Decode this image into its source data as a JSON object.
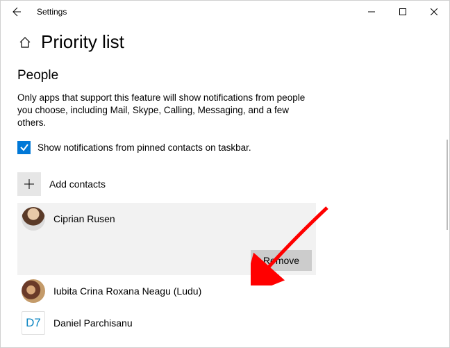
{
  "titlebar": {
    "title": "Settings"
  },
  "header": {
    "title": "Priority list"
  },
  "section": {
    "heading": "People",
    "description": "Only apps that support this feature will show notifications from people you choose, including Mail, Skype, Calling, Messaging, and a few others.",
    "checkbox_label": "Show notifications from pinned contacts on taskbar.",
    "checkbox_checked": true,
    "add_label": "Add contacts"
  },
  "contacts": [
    {
      "name": "Ciprian Rusen",
      "avatar_type": "photo1",
      "selected": true
    },
    {
      "name": "Iubita Crina Roxana Neagu (Ludu)",
      "avatar_type": "photo2",
      "selected": false
    },
    {
      "name": "Daniel Parchisanu",
      "avatar_type": "initials",
      "initials": "D7",
      "selected": false
    }
  ],
  "buttons": {
    "remove": "Remove"
  },
  "annotation": {
    "arrow_color": "#ff0000"
  }
}
